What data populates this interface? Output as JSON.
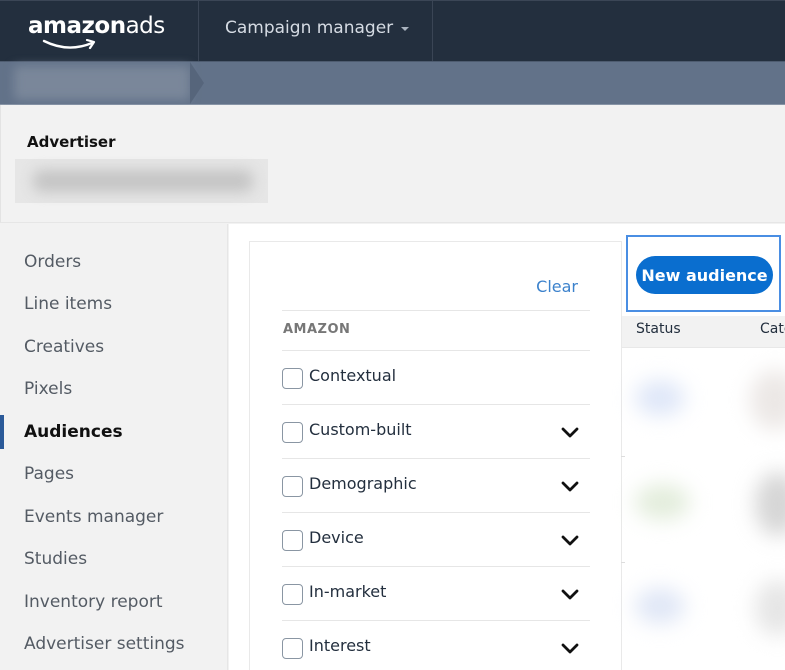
{
  "topnav": {
    "logo": {
      "bold": "amazon",
      "light": "ads",
      "icon": "amazon-smile-icon"
    },
    "app_switcher": {
      "label": "Campaign manager",
      "icon": "caret-down-icon"
    }
  },
  "breadcrumb": {
    "items": [
      {
        "label": "[redacted]",
        "blurred": true
      }
    ]
  },
  "advertiser": {
    "label": "Advertiser",
    "name": "[redacted]",
    "name_blurred": true
  },
  "sidebar": {
    "items": [
      {
        "label": "Orders",
        "active": false
      },
      {
        "label": "Line items",
        "active": false
      },
      {
        "label": "Creatives",
        "active": false
      },
      {
        "label": "Pixels",
        "active": false
      },
      {
        "label": "Audiences",
        "active": true
      },
      {
        "label": "Pages",
        "active": false
      },
      {
        "label": "Events manager",
        "active": false
      },
      {
        "label": "Studies",
        "active": false
      },
      {
        "label": "Inventory report",
        "active": false
      },
      {
        "label": "Advertiser settings",
        "active": false
      }
    ]
  },
  "filters": {
    "clear_label": "Clear",
    "group_label": "AMAZON",
    "items": [
      {
        "label": "Contextual",
        "checked": false,
        "expandable": false
      },
      {
        "label": "Custom-built",
        "checked": false,
        "expandable": true
      },
      {
        "label": "Demographic",
        "checked": false,
        "expandable": true
      },
      {
        "label": "Device",
        "checked": false,
        "expandable": true
      },
      {
        "label": "In-market",
        "checked": false,
        "expandable": true
      },
      {
        "label": "Interest",
        "checked": false,
        "expandable": true
      }
    ]
  },
  "results": {
    "new_audience_label": "New audience",
    "columns": [
      "Status",
      "Cate"
    ],
    "rows_blurred": true,
    "status_colors": [
      "#e8eefa",
      "#eaf3e6",
      "#e8eefa"
    ]
  },
  "colors": {
    "nav_bg": "#232f3e",
    "crumb_bg": "#627289",
    "accent": "#0a6ecf",
    "link": "#3c82cc",
    "focus": "#4a8ee3",
    "active_indicator": "#2b5a99"
  }
}
